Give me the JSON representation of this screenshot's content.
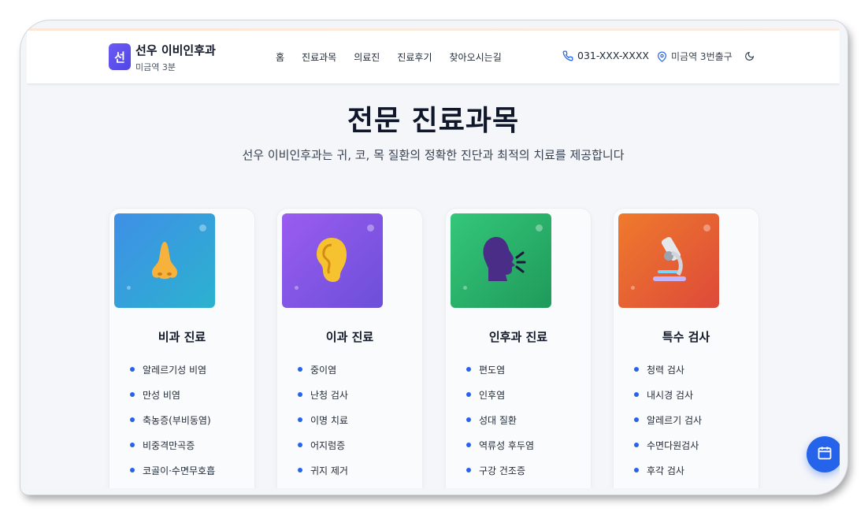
{
  "header": {
    "logo_letter": "선",
    "brand_name": "선우 이비인후과",
    "brand_sub": "미금역 3분",
    "nav": [
      "홈",
      "진료과목",
      "의료진",
      "진료후기",
      "찾아오시는길"
    ],
    "phone": "031-XXX-XXXX",
    "location": "미금역 3번출구"
  },
  "section": {
    "title": "전문 진료과목",
    "subtitle": "선우 이비인후과는 귀, 코, 목 질환의 정확한 진단과 최적의 치료를 제공합니다"
  },
  "cards": [
    {
      "title": "비과 진료",
      "icon": "nose-icon",
      "items": [
        "알레르기성 비염",
        "만성 비염",
        "축농증(부비동염)",
        "비중격만곡증",
        "코골이·수면무호흡"
      ]
    },
    {
      "title": "이과 진료",
      "icon": "ear-icon",
      "items": [
        "중이염",
        "난청 검사",
        "이명 치료",
        "어지럼증",
        "귀지 제거"
      ]
    },
    {
      "title": "인후과 진료",
      "icon": "throat-icon",
      "items": [
        "편도염",
        "인후염",
        "성대 질환",
        "역류성 후두염",
        "구강 건조증"
      ]
    },
    {
      "title": "특수 검사",
      "icon": "microscope-icon",
      "items": [
        "청력 검사",
        "내시경 검사",
        "알레르기 검사",
        "수면다원검사",
        "후각 검사"
      ]
    }
  ],
  "colors": {
    "accent": "#2563eb",
    "card1_bg": "#2b9fd8",
    "card2_bg": "#7b5ce6",
    "card3_bg": "#2fba6a",
    "card4_bg": "#e8643a"
  }
}
